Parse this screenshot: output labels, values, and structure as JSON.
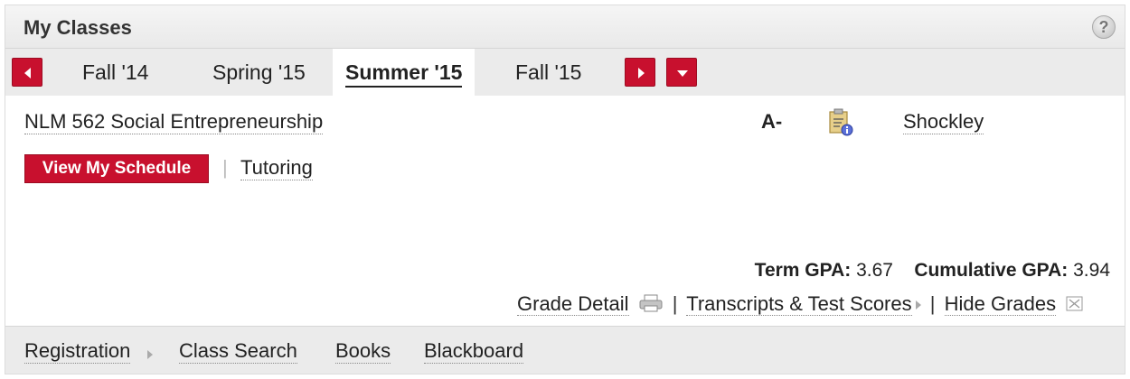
{
  "header": {
    "title": "My Classes",
    "help_icon": "?"
  },
  "terms": {
    "tabs": [
      {
        "label": "Fall '14",
        "active": false
      },
      {
        "label": "Spring '15",
        "active": false
      },
      {
        "label": "Summer '15",
        "active": true
      },
      {
        "label": "Fall '15",
        "active": false
      }
    ]
  },
  "class": {
    "course": "NLM 562 Social Entrepreneurship",
    "grade": "A-",
    "instructor": "Shockley",
    "icon": "class-info-clipboard-icon"
  },
  "actions": {
    "view_schedule": "View My Schedule",
    "separator": "|",
    "tutoring": "Tutoring"
  },
  "gpa": {
    "term_label": "Term GPA:",
    "term_value": "3.67",
    "cumulative_label": "Cumulative GPA:",
    "cumulative_value": "3.94"
  },
  "links": {
    "grade_detail": "Grade Detail",
    "transcripts": "Transcripts & Test Scores",
    "hide_grades": "Hide Grades",
    "separator": "|"
  },
  "bottom_nav": [
    "Registration",
    "Class Search",
    "Books",
    "Blackboard"
  ],
  "colors": {
    "accent": "#c8102e",
    "tab_bar": "#ebebeb"
  }
}
